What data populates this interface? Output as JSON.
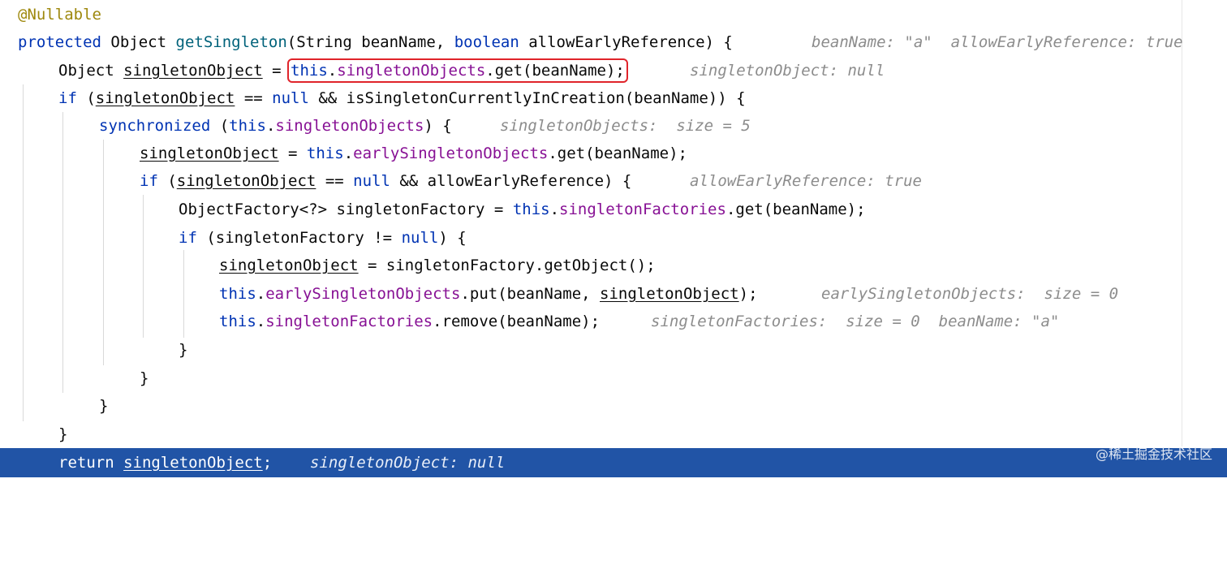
{
  "watermark": "@稀土掘金技术社区",
  "lines": {
    "l0": {
      "annotation": "@Nullable"
    },
    "l1": {
      "protected": "protected",
      "type": "Object",
      "method": "getSingleton",
      "params_open": "(String beanName, ",
      "boolean": "boolean",
      "params_close": " allowEarlyReference) {",
      "hint1": "beanName: \"a\"",
      "hint2": "allowEarlyReference: true"
    },
    "l2": {
      "type": "Object",
      "var": "singletonObject",
      "assign": " = ",
      "this": "this",
      "dot1": ".",
      "field": "singletonObjects",
      "call": ".get(beanName);",
      "hint": "singletonObject: null"
    },
    "l3": {
      "if": "if",
      "open": " (",
      "var": "singletonObject",
      "eq": " == ",
      "null": "null",
      "rest": " && isSingletonCurrentlyInCreation(beanName)) {"
    },
    "l4": {
      "sync": "synchronized",
      "open": " (",
      "this": "this",
      "dot": ".",
      "field": "singletonObjects",
      "close": ") {",
      "hint": "singletonObjects:  size = 5"
    },
    "l5": {
      "var": "singletonObject",
      "assign": " = ",
      "this": "this",
      "dot": ".",
      "field": "earlySingletonObjects",
      "call": ".get(beanName);"
    },
    "l6": {
      "if": "if",
      "open": " (",
      "var": "singletonObject",
      "eq": " == ",
      "null": "null",
      "rest": " && allowEarlyReference) {",
      "hint": "allowEarlyReference: true"
    },
    "l7": {
      "decl": "ObjectFactory<?> singletonFactory = ",
      "this": "this",
      "dot": ".",
      "field": "singletonFactories",
      "call": ".get(beanName);"
    },
    "l8": {
      "if": "if",
      "open": " (singletonFactory != ",
      "null": "null",
      "close": ") {"
    },
    "l9": {
      "var": "singletonObject",
      "rest": " = singletonFactory.getObject();"
    },
    "l10": {
      "this": "this",
      "dot": ".",
      "field": "earlySingletonObjects",
      "call": ".put(beanName, ",
      "var": "singletonObject",
      "close": ");",
      "hint": "earlySingletonObjects:  size = 0"
    },
    "l11": {
      "this": "this",
      "dot": ".",
      "field": "singletonFactories",
      "call": ".remove(beanName);",
      "hint1": "singletonFactories:  size = 0",
      "hint2": "beanName: \"a\""
    },
    "l12": {
      "brace": "}"
    },
    "l13": {
      "brace": "}"
    },
    "l14": {
      "brace": "}"
    },
    "l15": {
      "brace": "}"
    },
    "l16": {
      "return": "return",
      "var": "singletonObject",
      "semi": ";",
      "hint": "singletonObject: null"
    }
  }
}
